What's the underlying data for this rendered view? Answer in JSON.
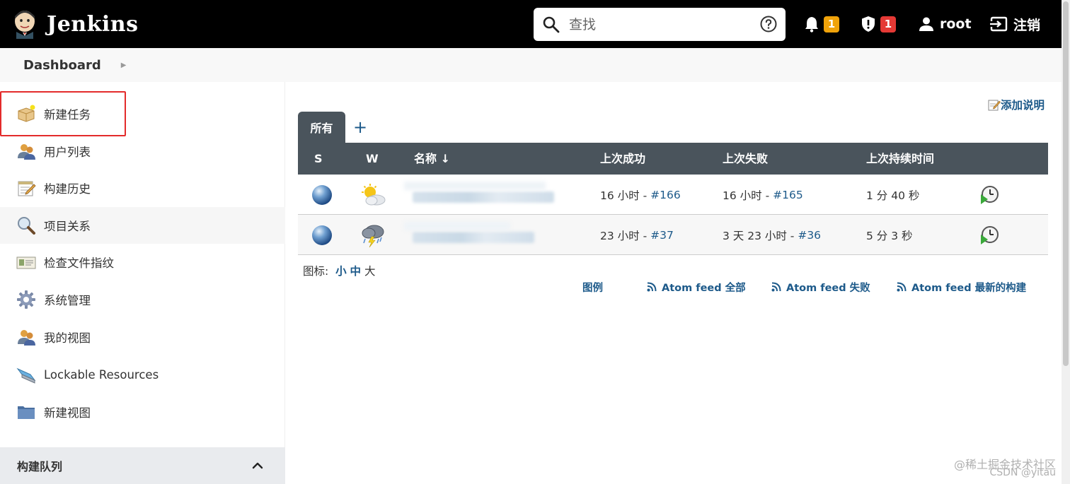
{
  "header": {
    "title": "Jenkins",
    "search_placeholder": "查找",
    "notifications_count": "1",
    "security_count": "1",
    "user": "root",
    "logout": "注销",
    "colors": {
      "bar": "#000000",
      "notif_badge": "#f0a30a",
      "security_badge": "#e53935"
    }
  },
  "breadcrumb": {
    "root": "Dashboard"
  },
  "sidebar": {
    "items": [
      {
        "label": "新建任务",
        "icon": "new-item-icon"
      },
      {
        "label": "用户列表",
        "icon": "people-icon"
      },
      {
        "label": "构建历史",
        "icon": "notepad-icon"
      },
      {
        "label": "项目关系",
        "icon": "search-magnifier-icon"
      },
      {
        "label": "检查文件指纹",
        "icon": "fingerprint-icon"
      },
      {
        "label": "系统管理",
        "icon": "gear-icon"
      },
      {
        "label": "我的视图",
        "icon": "user-icon"
      },
      {
        "label": "Lockable Resources",
        "icon": "drive-icon"
      },
      {
        "label": "新建视图",
        "icon": "folder-icon"
      }
    ],
    "build_queue_title": "构建队列"
  },
  "main": {
    "add_description": "添加说明",
    "tabs": [
      {
        "label": "所有"
      }
    ],
    "add_tab_label": "+",
    "table": {
      "headers": {
        "s": "S",
        "w": "W",
        "name": "名称 ↓",
        "last_success": "上次成功",
        "last_failure": "上次失败",
        "last_duration": "上次持续时间"
      },
      "rows": [
        {
          "status": "blue",
          "weather": "sun-cloud",
          "last_success_time": "16 小时 - ",
          "last_success_build": "#166",
          "last_failure_time": "16 小时 - ",
          "last_failure_build": "#165",
          "duration": "1 分 40 秒"
        },
        {
          "status": "blue",
          "weather": "storm",
          "last_success_time": "23 小时 - ",
          "last_success_build": "#37",
          "last_failure_time": "3 天 23 小时 - ",
          "last_failure_build": "#36",
          "duration": "5 分 3 秒"
        }
      ]
    },
    "icon_size": {
      "label": "图标: ",
      "small": "小",
      "medium": "中",
      "large": "大"
    },
    "footer": {
      "legend": "图例",
      "atom_all": "Atom feed 全部",
      "atom_fail": "Atom feed 失败",
      "atom_latest": "Atom feed 最新的构建"
    }
  },
  "watermark": {
    "line1": "@稀土掘金技术社区",
    "line2": "CSDN @yitau"
  }
}
